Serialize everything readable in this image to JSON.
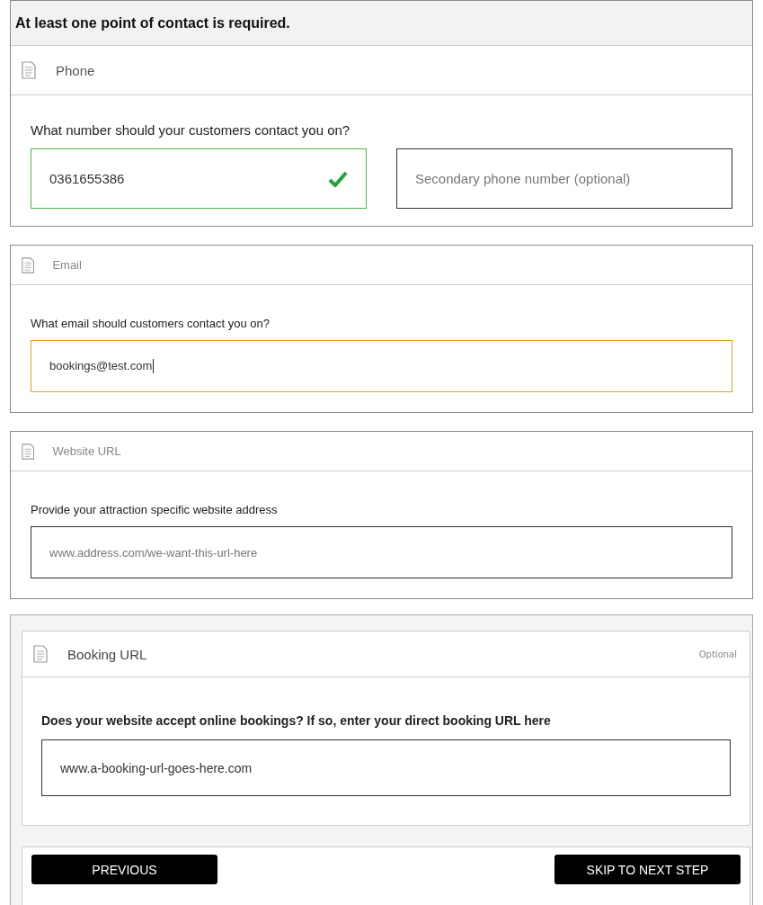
{
  "notice": "At least one point of contact is required.",
  "sections": [
    {
      "kind": "contact",
      "title": "Phone",
      "question": "What number should your customers contact you on?",
      "fields": [
        {
          "value": "0361655386",
          "valid": true,
          "focused": false
        },
        {
          "placeholder": "Secondary phone number (optional)",
          "valid": false,
          "focused": false
        }
      ]
    },
    {
      "kind": "contact",
      "title": "Email",
      "question": "What email should customers contact you on?",
      "fields": [
        {
          "value": "bookings@test.com",
          "valid": false,
          "focused": true
        }
      ]
    },
    {
      "kind": "contact",
      "title": "Website URL",
      "question": "Provide your attraction specific website address",
      "fields": [
        {
          "placeholder": "www.address.com/we-want-this-url-here",
          "valid": false,
          "focused": false
        }
      ]
    },
    {
      "kind": "booking",
      "title": "Booking URL",
      "badge": "Optional",
      "question": "Does your website accept online bookings? If so, enter your direct booking URL here",
      "fields": [
        {
          "value": "www.a-booking-url-goes-here.com",
          "valid": false,
          "focused": false
        }
      ]
    }
  ],
  "buttons": [
    {
      "label": "PREVIOUS"
    },
    {
      "label": "SKIP TO NEXT STEP"
    }
  ]
}
